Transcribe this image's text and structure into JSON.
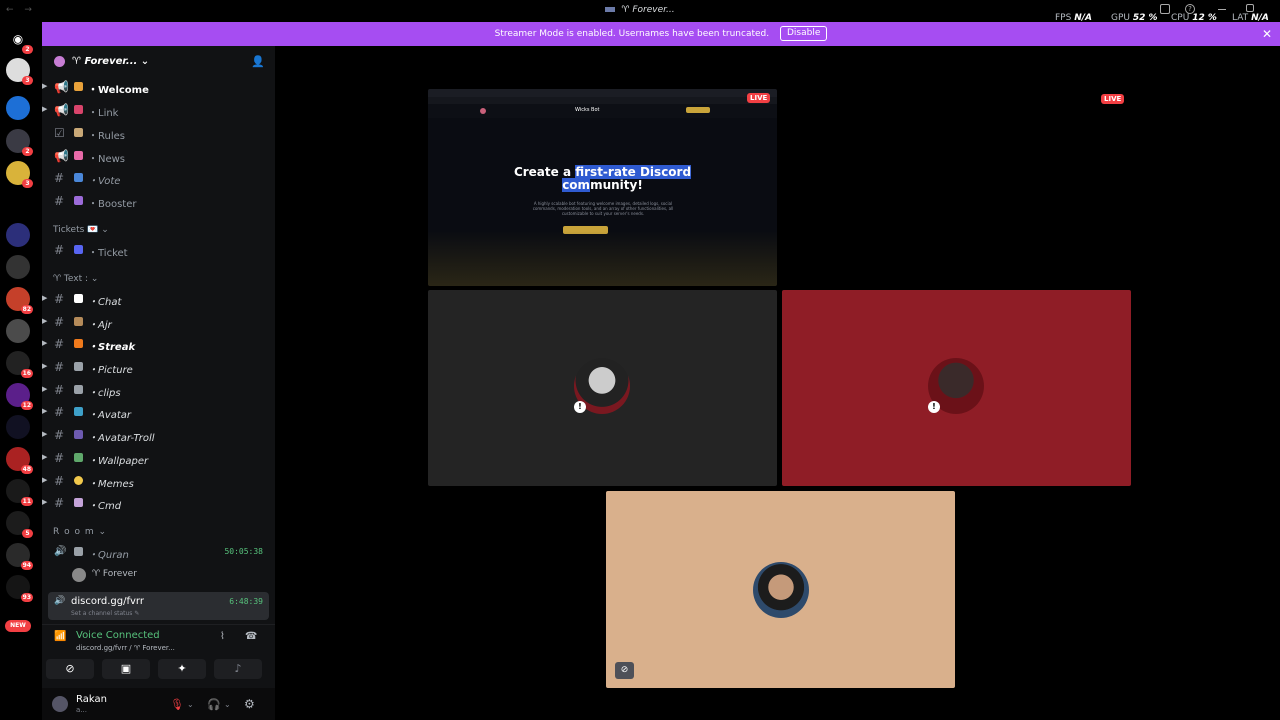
{
  "titlebar": {
    "nav": "← →",
    "title": "♈ Forever...",
    "fps_label": "FPS",
    "fps_value": "N/A",
    "gpu_label": "GPU",
    "gpu_value": "52 %",
    "cpu_label": "CPU",
    "cpu_value": "12 %",
    "lat_label": "LAT",
    "lat_value": "N/A"
  },
  "banner": {
    "text": "Streamer Mode is enabled. Usernames have been truncated.",
    "disable_label": "Disable",
    "close": "✕"
  },
  "guilds": {
    "badges": [
      "2",
      "3",
      "",
      "2",
      "3",
      "",
      "",
      "",
      "82",
      "",
      "16",
      "12",
      "",
      "48",
      "11",
      "5",
      "94",
      "93"
    ],
    "new_label": "NEW"
  },
  "server": {
    "name": "♈ Forever... ⌄",
    "invite_icon": "add-person-icon"
  },
  "channels_top": [
    {
      "label": "・Welcome",
      "type": "announce",
      "style": "bold"
    },
    {
      "label": "・Link",
      "type": "announce",
      "style": "dim"
    },
    {
      "label": "・Rules",
      "type": "rules",
      "style": "dim"
    },
    {
      "label": "・News",
      "type": "announce",
      "style": "dim"
    },
    {
      "label": "・Vote",
      "type": "text",
      "style": "dim-it"
    },
    {
      "label": "・Booster",
      "type": "text",
      "style": "dim"
    }
  ],
  "categories": {
    "tickets": "Tickets 💌 ⌄",
    "text": "♈ Text : ⌄",
    "room": "R o o m ⌄"
  },
  "ticket_channel": "・Ticket",
  "text_channels": [
    {
      "label": "・Chat"
    },
    {
      "label": "・Ajr"
    },
    {
      "label": "・Streak"
    },
    {
      "label": "・Picture"
    },
    {
      "label": "・clips"
    },
    {
      "label": "・Avatar"
    },
    {
      "label": "・Avatar-Troll"
    },
    {
      "label": "・Wallpaper"
    },
    {
      "label": "・Memes"
    },
    {
      "label": "・Cmd"
    }
  ],
  "voice_channels": {
    "quran": "・Quran",
    "quran_time": "50:05:38",
    "quran_member": "♈ Forever",
    "active_name": "discord.gg/fvrr",
    "active_status": "Set a channel status ✎",
    "active_time": "6:48:39"
  },
  "voice_panel": {
    "title": "Voice Connected",
    "subtitle": "discord.gg/fvrr / ♈ Forever..."
  },
  "user": {
    "name": "Rakan",
    "status": "a..."
  },
  "stage": {
    "live_label": "LIVE",
    "stream_brand": "Wicks Bot",
    "stream_headline_a": "Create a ",
    "stream_headline_b": "first-rate Discord",
    "stream_headline_c": "com",
    "stream_headline_d": "munity!",
    "stream_sub": "A highly scalable bot featuring welcome images, detailed logs, social commands, moderation tools, and an array of other functionalities, all customizable to suit your server's needs."
  },
  "colors": {
    "accent_banner": "#a64df2",
    "voice_green": "#57c27c",
    "red_tile": "#8f1d26",
    "peach_tile": "#d9b08c",
    "dark_tile": "#242424",
    "live_red": "#f23f43"
  }
}
